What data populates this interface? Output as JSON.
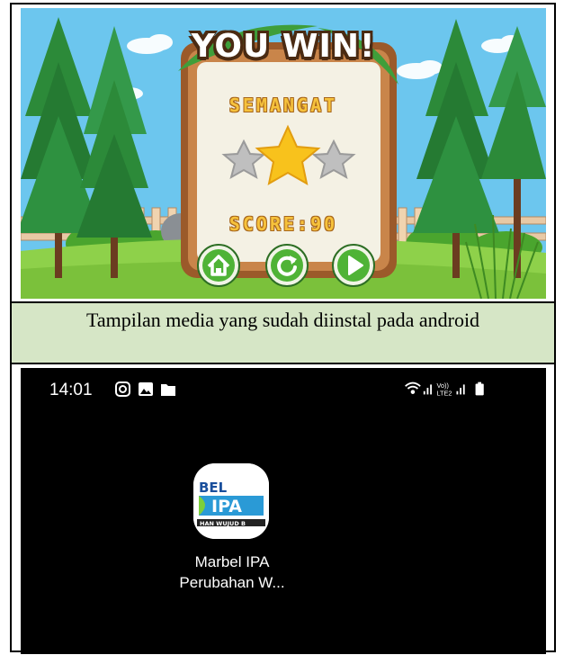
{
  "game": {
    "title": "YOU WIN!",
    "message": "SEMANGAT",
    "score": "SCORE:90",
    "stars": 1,
    "stars_max": 3,
    "buttons": [
      {
        "icon": "home-icon"
      },
      {
        "icon": "replay-icon"
      },
      {
        "icon": "play-icon"
      }
    ]
  },
  "caption": "Tampilan media yang sudah diinstal pada android",
  "phone": {
    "time": "14:01",
    "status_left_icons": [
      "instagram-icon",
      "gallery-icon",
      "folder-icon"
    ],
    "status_right_icons": [
      "wifi-icon",
      "signal-icon",
      "volte-lte2-icon",
      "signal-icon",
      "battery-icon"
    ],
    "volte_text": "Vo))",
    "lte_text": "LTE2",
    "app": {
      "icon_text_top": "BEL",
      "icon_text_mid": "IPA",
      "icon_text_bottom": "HAN WUJUD B",
      "label_line1": "Marbel IPA",
      "label_line2": "Perubahan W..."
    }
  }
}
